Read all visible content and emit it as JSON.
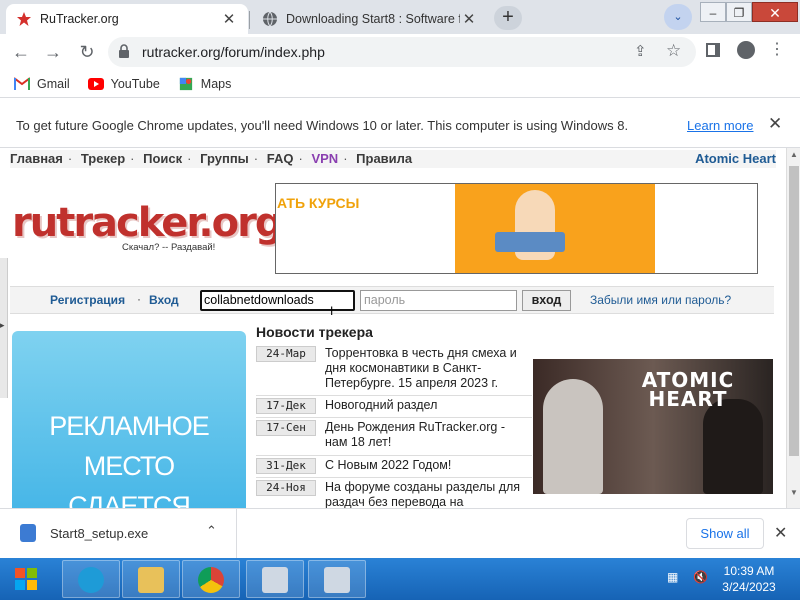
{
  "tabs": [
    {
      "title": "RuTracker.org",
      "active": true
    },
    {
      "title": "Downloading Start8 : Software fr",
      "active": false
    }
  ],
  "toolbar": {
    "url": "rutracker.org/forum/index.php"
  },
  "bookmarks": [
    {
      "label": "Gmail",
      "icon": "gmail-icon"
    },
    {
      "label": "YouTube",
      "icon": "youtube-icon"
    },
    {
      "label": "Maps",
      "icon": "maps-icon"
    }
  ],
  "infobar": {
    "message": "To get future Google Chrome updates, you'll need Windows 10 or later. This computer is using Windows 8.",
    "link": "Learn more"
  },
  "site": {
    "nav": [
      "Главная",
      "Трекер",
      "Поиск",
      "Группы",
      "FAQ",
      "VPN",
      "Правила"
    ],
    "nav_right": "Atomic Heart",
    "logo_text": "rutracker.org",
    "slogan": "Скачал? -- Раздавай!",
    "banner_text": "АТЬ КУРСЫ",
    "login": {
      "register": "Регистрация",
      "enter": "Вход",
      "username": "collabnetdownloads",
      "password_placeholder": "пароль",
      "submit": "вход",
      "forgot": "Забыли имя или пароль?"
    },
    "ad_lines": [
      "РЕКЛАМНОЕ",
      "МЕСТО",
      "СДАЕТСЯ"
    ],
    "news_title": "Новости трекера",
    "news": [
      {
        "date": "24-Мар",
        "text": "Торрентовка в честь дня смеха и дня космонавтики в Санкт-Петербурге. 15 апреля 2023 г."
      },
      {
        "date": "17-Дек",
        "text": "Новогодний раздел"
      },
      {
        "date": "17-Сен",
        "text": "День Рождения RuTracker.org - нам 18 лет!"
      },
      {
        "date": "31-Дек",
        "text": "С Новым 2022 Годом!"
      },
      {
        "date": "24-Ноя",
        "text": "На форуме созданы разделы для раздач без перевода на"
      }
    ],
    "game_banner_lines": [
      "ATOMIC",
      "HEART"
    ]
  },
  "downloads": {
    "filename": "Start8_setup.exe",
    "show_all": "Show all"
  },
  "taskbar": {
    "time": "10:39 AM",
    "date": "3/24/2023"
  }
}
